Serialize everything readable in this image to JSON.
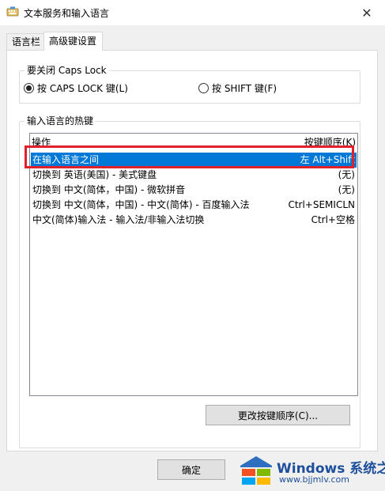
{
  "window": {
    "title": "文本服务和输入语言",
    "close_glyph": "✕"
  },
  "tabs": [
    {
      "label": "语言栏",
      "active": false
    },
    {
      "label": "高级键设置",
      "active": true
    }
  ],
  "caps_group": {
    "legend": "要关闭 Caps Lock",
    "options": [
      {
        "label": "按 CAPS LOCK 键(L)",
        "checked": true
      },
      {
        "label": "按 SHIFT 键(F)",
        "checked": false
      }
    ]
  },
  "hotkey_group": {
    "legend": "输入语言的热键",
    "columns": {
      "action": "操作",
      "key_sequence": "按键顺序(K)"
    },
    "rows": [
      {
        "action": "在输入语言之间",
        "keys": "左 Alt+Shift",
        "selected": true
      },
      {
        "action": "切换到 英语(美国) - 美式键盘",
        "keys": "(无)",
        "selected": false
      },
      {
        "action": "切换到 中文(简体，中国) - 微软拼音",
        "keys": "(无)",
        "selected": false
      },
      {
        "action": "切换到 中文(简体，中国) - 中文(简体) - 百度输入法",
        "keys": "Ctrl+SEMICLN",
        "selected": false
      },
      {
        "action": "中文(简体)输入法 - 输入法/非输入法切换",
        "keys": "Ctrl+空格",
        "selected": false
      }
    ],
    "change_button": "更改按键顺序(C)..."
  },
  "footer": {
    "ok_button": "确定"
  },
  "watermark": {
    "brand": "Windows 系统之家",
    "url": "www.bjjmlv.com"
  },
  "colors": {
    "selection": "#0078d7",
    "highlight_border": "#e0202a",
    "watermark": "#1d4f9c"
  },
  "icons": {
    "title": "keyboard-icon",
    "close": "close-icon",
    "watermark": "windows-logo-icon"
  }
}
